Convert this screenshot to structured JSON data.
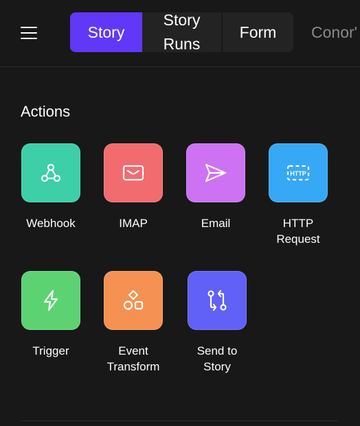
{
  "header": {
    "tabs": [
      {
        "label": "Story",
        "active": true
      },
      {
        "label": "Story\nRuns",
        "active": false
      },
      {
        "label": "Form",
        "active": false
      },
      {
        "label": "Conor'",
        "active": false
      }
    ]
  },
  "section": {
    "title": "Actions"
  },
  "actions": [
    {
      "label": "Webhook",
      "icon": "webhook-icon",
      "color": "#3ccfa8"
    },
    {
      "label": "IMAP",
      "icon": "mail-icon",
      "color": "#f26b6f"
    },
    {
      "label": "Email",
      "icon": "send-icon",
      "color": "#cc72f2"
    },
    {
      "label": "HTTP\nRequest",
      "icon": "http-icon",
      "color": "#37a8f6"
    },
    {
      "label": "Trigger",
      "icon": "lightning-icon",
      "color": "#5cd273"
    },
    {
      "label": "Event\nTransform",
      "icon": "shapes-icon",
      "color": "#f59152"
    },
    {
      "label": "Send to\nStory",
      "icon": "transfer-icon",
      "color": "#6160f7"
    }
  ]
}
